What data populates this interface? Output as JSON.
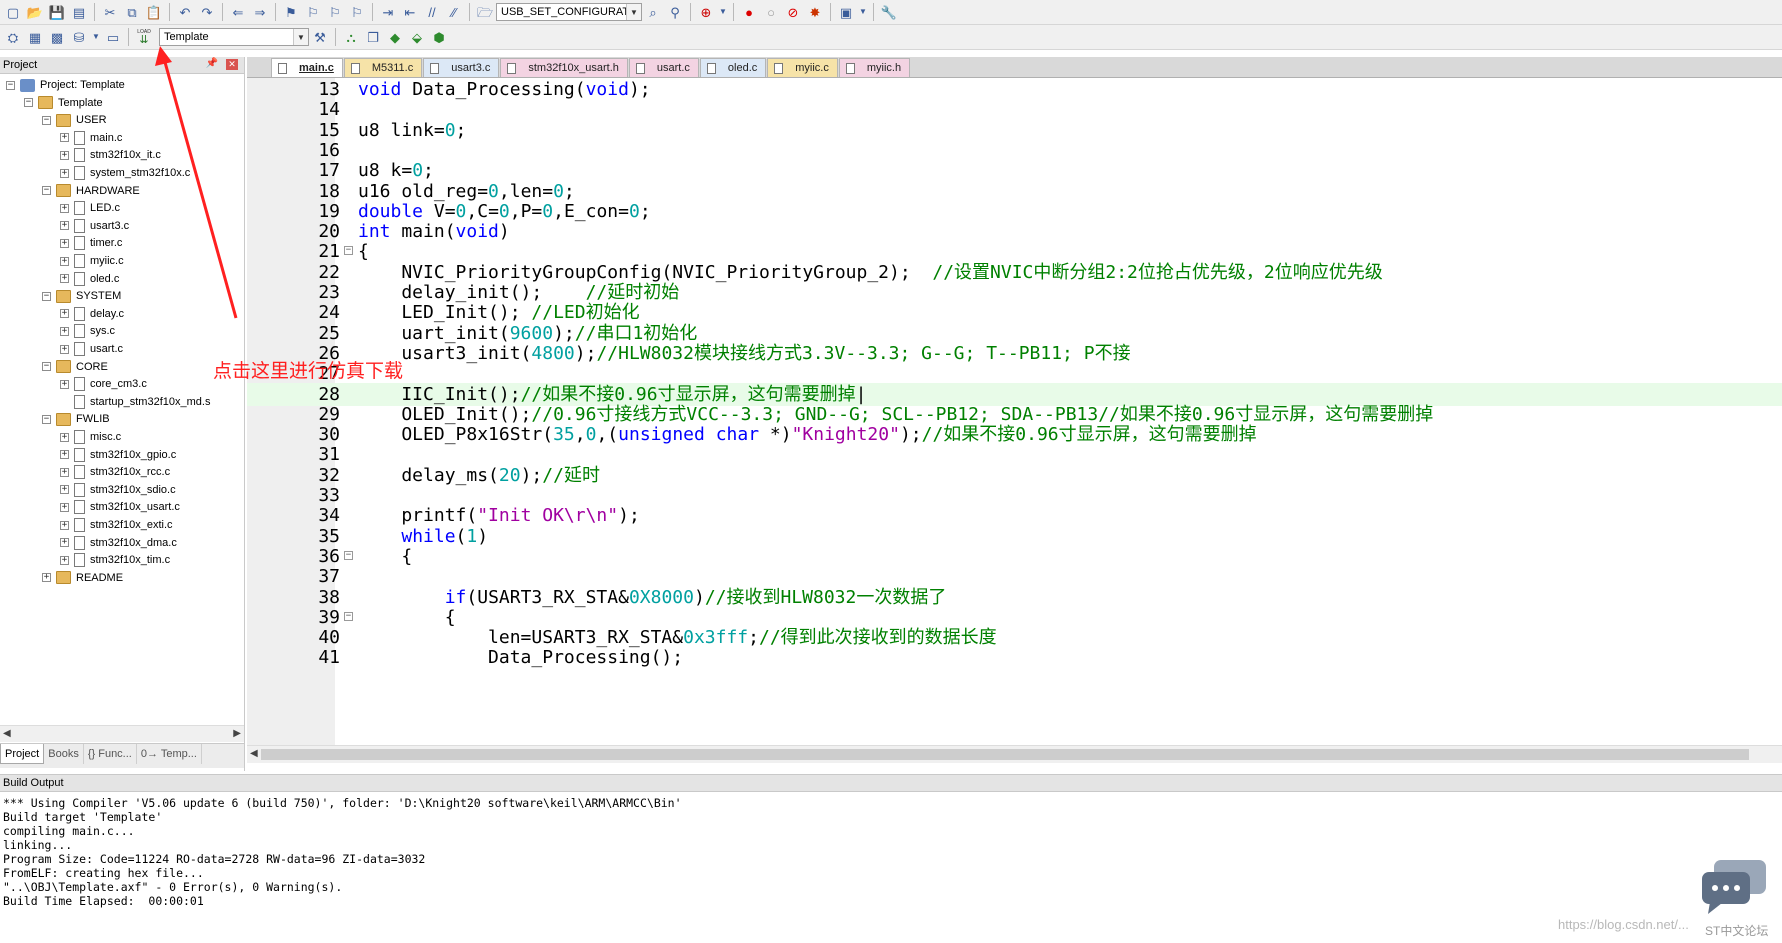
{
  "toolbar1": {
    "target_combo": "USB_SET_CONFIGURATIO"
  },
  "toolbar2": {
    "target_select": "Template",
    "load_label": "LOAD"
  },
  "project_panel": {
    "title": "Project",
    "tree": [
      {
        "label": "Project: Template",
        "level": 0,
        "kind": "proj",
        "expand": "-"
      },
      {
        "label": "Template",
        "level": 1,
        "kind": "folder",
        "expand": "-"
      },
      {
        "label": "USER",
        "level": 2,
        "kind": "folder",
        "expand": "-"
      },
      {
        "label": "main.c",
        "level": 3,
        "kind": "file",
        "expand": "+"
      },
      {
        "label": "stm32f10x_it.c",
        "level": 3,
        "kind": "file",
        "expand": "+"
      },
      {
        "label": "system_stm32f10x.c",
        "level": 3,
        "kind": "file",
        "expand": "+"
      },
      {
        "label": "HARDWARE",
        "level": 2,
        "kind": "folder",
        "expand": "-"
      },
      {
        "label": "LED.c",
        "level": 3,
        "kind": "file",
        "expand": "+"
      },
      {
        "label": "usart3.c",
        "level": 3,
        "kind": "file",
        "expand": "+"
      },
      {
        "label": "timer.c",
        "level": 3,
        "kind": "file",
        "expand": "+"
      },
      {
        "label": "myiic.c",
        "level": 3,
        "kind": "file",
        "expand": "+"
      },
      {
        "label": "oled.c",
        "level": 3,
        "kind": "file",
        "expand": "+"
      },
      {
        "label": "SYSTEM",
        "level": 2,
        "kind": "folder",
        "expand": "-"
      },
      {
        "label": "delay.c",
        "level": 3,
        "kind": "file",
        "expand": "+"
      },
      {
        "label": "sys.c",
        "level": 3,
        "kind": "file",
        "expand": "+"
      },
      {
        "label": "usart.c",
        "level": 3,
        "kind": "file",
        "expand": "+"
      },
      {
        "label": "CORE",
        "level": 2,
        "kind": "folder",
        "expand": "-"
      },
      {
        "label": "core_cm3.c",
        "level": 3,
        "kind": "file",
        "expand": "+"
      },
      {
        "label": "startup_stm32f10x_md.s",
        "level": 3,
        "kind": "file",
        "expand": ""
      },
      {
        "label": "FWLIB",
        "level": 2,
        "kind": "folder",
        "expand": "-"
      },
      {
        "label": "misc.c",
        "level": 3,
        "kind": "file",
        "expand": "+"
      },
      {
        "label": "stm32f10x_gpio.c",
        "level": 3,
        "kind": "file",
        "expand": "+"
      },
      {
        "label": "stm32f10x_rcc.c",
        "level": 3,
        "kind": "file",
        "expand": "+"
      },
      {
        "label": "stm32f10x_sdio.c",
        "level": 3,
        "kind": "file",
        "expand": "+"
      },
      {
        "label": "stm32f10x_usart.c",
        "level": 3,
        "kind": "file",
        "expand": "+"
      },
      {
        "label": "stm32f10x_exti.c",
        "level": 3,
        "kind": "file",
        "expand": "+"
      },
      {
        "label": "stm32f10x_dma.c",
        "level": 3,
        "kind": "file",
        "expand": "+"
      },
      {
        "label": "stm32f10x_tim.c",
        "level": 3,
        "kind": "file",
        "expand": "+"
      },
      {
        "label": "README",
        "level": 2,
        "kind": "folder",
        "expand": "+"
      }
    ],
    "tabs": [
      {
        "label": "Project",
        "active": true
      },
      {
        "label": "Books",
        "active": false
      },
      {
        "label": "{} Func...",
        "active": false
      },
      {
        "label": "0→ Temp...",
        "active": false
      }
    ]
  },
  "file_tabs": [
    {
      "label": "main.c",
      "kind": "active"
    },
    {
      "label": "M5311.c",
      "kind": "c"
    },
    {
      "label": "usart3.c",
      "kind": "c2"
    },
    {
      "label": "stm32f10x_usart.h",
      "kind": "h"
    },
    {
      "label": "usart.c",
      "kind": "h"
    },
    {
      "label": "oled.c",
      "kind": "c2"
    },
    {
      "label": "myiic.c",
      "kind": "c"
    },
    {
      "label": "myiic.h",
      "kind": "h"
    }
  ],
  "code_lines": [
    {
      "n": "13",
      "fold": "",
      "hl": false,
      "seg": [
        [
          "kw",
          "void"
        ],
        [
          "t",
          " Data_Processing("
        ],
        [
          "kw",
          "void"
        ],
        [
          "t",
          ");"
        ]
      ]
    },
    {
      "n": "14",
      "fold": "",
      "hl": false,
      "seg": []
    },
    {
      "n": "15",
      "fold": "",
      "hl": false,
      "seg": [
        [
          "t",
          "u8 link="
        ],
        [
          "num",
          "0"
        ],
        [
          "t",
          ";"
        ]
      ]
    },
    {
      "n": "16",
      "fold": "",
      "hl": false,
      "seg": []
    },
    {
      "n": "17",
      "fold": "",
      "hl": false,
      "seg": [
        [
          "t",
          "u8 k="
        ],
        [
          "num",
          "0"
        ],
        [
          "t",
          ";"
        ]
      ]
    },
    {
      "n": "18",
      "fold": "",
      "hl": false,
      "seg": [
        [
          "t",
          "u16 old_reg="
        ],
        [
          "num",
          "0"
        ],
        [
          "t",
          ",len="
        ],
        [
          "num",
          "0"
        ],
        [
          "t",
          ";"
        ]
      ]
    },
    {
      "n": "19",
      "fold": "",
      "hl": false,
      "seg": [
        [
          "kw",
          "double"
        ],
        [
          "t",
          " V="
        ],
        [
          "num",
          "0"
        ],
        [
          "t",
          ",C="
        ],
        [
          "num",
          "0"
        ],
        [
          "t",
          ",P="
        ],
        [
          "num",
          "0"
        ],
        [
          "t",
          ",E_con="
        ],
        [
          "num",
          "0"
        ],
        [
          "t",
          ";"
        ]
      ]
    },
    {
      "n": "20",
      "fold": "",
      "hl": false,
      "seg": [
        [
          "kw",
          "int"
        ],
        [
          "t",
          " main("
        ],
        [
          "kw",
          "void"
        ],
        [
          "t",
          ")"
        ]
      ]
    },
    {
      "n": "21",
      "fold": "-",
      "hl": false,
      "seg": [
        [
          "t",
          "{"
        ]
      ]
    },
    {
      "n": "22",
      "fold": "",
      "hl": false,
      "seg": [
        [
          "t",
          "    NVIC_PriorityGroupConfig(NVIC_PriorityGroup_2);  "
        ],
        [
          "cm",
          "//设置NVIC中断分组2:2位抢占优先级，2位响应优先级"
        ]
      ]
    },
    {
      "n": "23",
      "fold": "",
      "hl": false,
      "seg": [
        [
          "t",
          "    delay_init();    "
        ],
        [
          "cm",
          "//延时初始"
        ]
      ]
    },
    {
      "n": "24",
      "fold": "",
      "hl": false,
      "seg": [
        [
          "t",
          "    LED_Init(); "
        ],
        [
          "cm",
          "//LED初始化"
        ]
      ]
    },
    {
      "n": "25",
      "fold": "",
      "hl": false,
      "seg": [
        [
          "t",
          "    uart_init("
        ],
        [
          "num",
          "9600"
        ],
        [
          "t",
          ");"
        ],
        [
          "cm",
          "//串口1初始化"
        ]
      ]
    },
    {
      "n": "26",
      "fold": "",
      "hl": false,
      "seg": [
        [
          "t",
          "    usart3_init("
        ],
        [
          "num",
          "4800"
        ],
        [
          "t",
          ");"
        ],
        [
          "cm",
          "//HLW8032模块接线方式3.3V--3.3; G--G; T--PB11; P不接"
        ]
      ]
    },
    {
      "n": "27",
      "fold": "",
      "hl": false,
      "seg": []
    },
    {
      "n": "28",
      "fold": "",
      "hl": true,
      "seg": [
        [
          "t",
          "    IIC_Init();"
        ],
        [
          "cm",
          "//如果不接0.96寸显示屏，这句需要删掉"
        ],
        [
          "t",
          "|"
        ]
      ]
    },
    {
      "n": "29",
      "fold": "",
      "hl": false,
      "seg": [
        [
          "t",
          "    OLED_Init();"
        ],
        [
          "cm",
          "//0.96寸接线方式VCC--3.3; GND--G; SCL--PB12; SDA--PB13//如果不接0.96寸显示屏，这句需要删掉"
        ]
      ]
    },
    {
      "n": "30",
      "fold": "",
      "hl": false,
      "seg": [
        [
          "t",
          "    OLED_P8x16Str("
        ],
        [
          "num",
          "35"
        ],
        [
          "t",
          ","
        ],
        [
          "num",
          "0"
        ],
        [
          "t",
          ",("
        ],
        [
          "kw",
          "unsigned"
        ],
        [
          "t",
          " "
        ],
        [
          "kw",
          "char"
        ],
        [
          "t",
          " *)"
        ],
        [
          "str",
          "\"Knight20\""
        ],
        [
          "t",
          ");"
        ],
        [
          "cm",
          "//如果不接0.96寸显示屏，这句需要删掉"
        ]
      ]
    },
    {
      "n": "31",
      "fold": "",
      "hl": false,
      "seg": []
    },
    {
      "n": "32",
      "fold": "",
      "hl": false,
      "seg": [
        [
          "t",
          "    delay_ms("
        ],
        [
          "num",
          "20"
        ],
        [
          "t",
          ");"
        ],
        [
          "cm",
          "//延时"
        ]
      ]
    },
    {
      "n": "33",
      "fold": "",
      "hl": false,
      "seg": []
    },
    {
      "n": "34",
      "fold": "",
      "hl": false,
      "seg": [
        [
          "t",
          "    printf("
        ],
        [
          "str",
          "\"Init OK\\r\\n\""
        ],
        [
          "t",
          ");"
        ]
      ]
    },
    {
      "n": "35",
      "fold": "",
      "hl": false,
      "seg": [
        [
          "t",
          "    "
        ],
        [
          "kw",
          "while"
        ],
        [
          "t",
          "("
        ],
        [
          "num",
          "1"
        ],
        [
          "t",
          ")"
        ]
      ]
    },
    {
      "n": "36",
      "fold": "-",
      "hl": false,
      "seg": [
        [
          "t",
          "    {"
        ]
      ]
    },
    {
      "n": "37",
      "fold": "",
      "hl": false,
      "seg": []
    },
    {
      "n": "38",
      "fold": "",
      "hl": false,
      "seg": [
        [
          "t",
          "        "
        ],
        [
          "kw",
          "if"
        ],
        [
          "t",
          "(USART3_RX_STA&"
        ],
        [
          "num",
          "0X8000"
        ],
        [
          "t",
          ")"
        ],
        [
          "cm",
          "//接收到HLW8032一次数据了"
        ]
      ]
    },
    {
      "n": "39",
      "fold": "-",
      "hl": false,
      "seg": [
        [
          "t",
          "        {"
        ]
      ]
    },
    {
      "n": "40",
      "fold": "",
      "hl": false,
      "seg": [
        [
          "t",
          "            len=USART3_RX_STA&"
        ],
        [
          "num",
          "0x3fff"
        ],
        [
          "t",
          ";"
        ],
        [
          "cm",
          "//得到此次接收到的数据长度"
        ]
      ]
    },
    {
      "n": "41",
      "fold": "",
      "hl": false,
      "seg": [
        [
          "t",
          "            Data_Processing();"
        ]
      ]
    }
  ],
  "build_output": {
    "title": "Build Output",
    "lines": [
      "*** Using Compiler 'V5.06 update 6 (build 750)', folder: 'D:\\Knight20 software\\keil\\ARM\\ARMCC\\Bin'",
      "Build target 'Template'",
      "compiling main.c...",
      "linking...",
      "Program Size: Code=11224 RO-data=2728 RW-data=96 ZI-data=3032",
      "FromELF: creating hex file...",
      "\"..\\OBJ\\Template.axf\" - 0 Error(s), 0 Warning(s).",
      "Build Time Elapsed:  00:00:01"
    ]
  },
  "annotation": {
    "text": "点击这里进行仿真下载",
    "color": "#ff2020"
  },
  "watermark": {
    "url": "https://blog.csdn.net/...",
    "brand": "ST中文论坛"
  }
}
